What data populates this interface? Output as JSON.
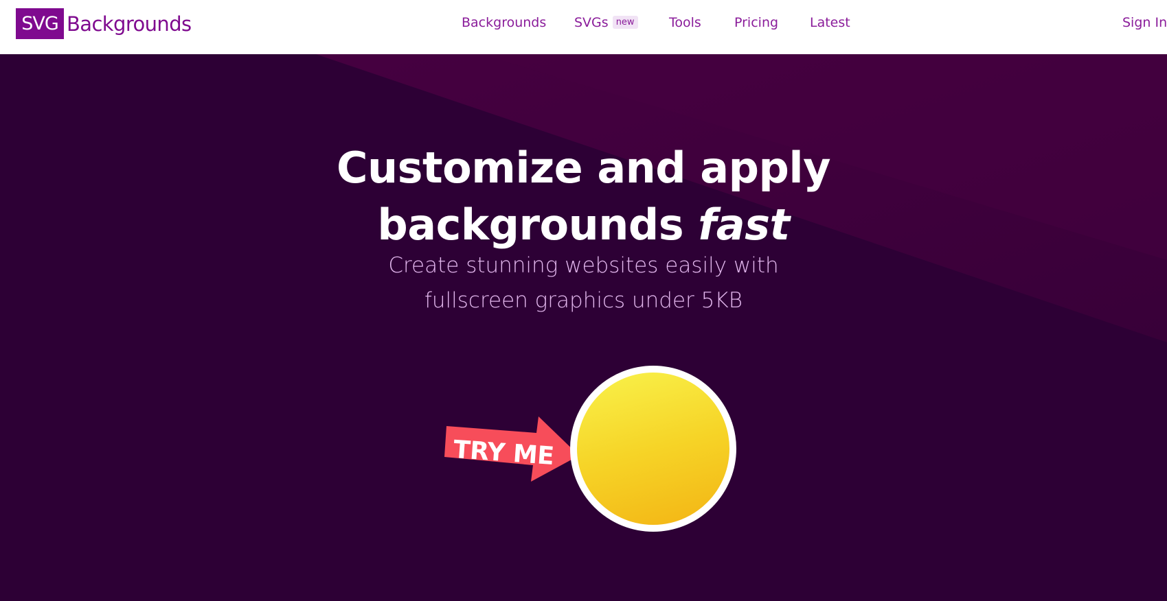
{
  "nav": {
    "logo_box": "SVG",
    "logo_text": "Backgrounds",
    "links": [
      {
        "label": "Backgrounds"
      },
      {
        "label": "SVGs",
        "badge": "new"
      },
      {
        "label": "Tools"
      },
      {
        "label": "Pricing"
      },
      {
        "label": "Latest"
      }
    ],
    "sign_in": "Sign In"
  },
  "hero": {
    "headline_line1": "Customize and apply",
    "headline_line2": "backgrounds ",
    "headline_emphasis": "fast",
    "subhead_line1": "Create stunning websites easily with",
    "subhead_line2": "fullscreen graphics under 5KB",
    "try_label": "TRY ME"
  },
  "colors": {
    "brand": "#7f0a8f",
    "hero_bg": "#2d0035",
    "hero_accent": "#4a0042",
    "arrow": "#f74d5a",
    "circle_top": "#f9f24b",
    "circle_bottom": "#f3b414"
  }
}
